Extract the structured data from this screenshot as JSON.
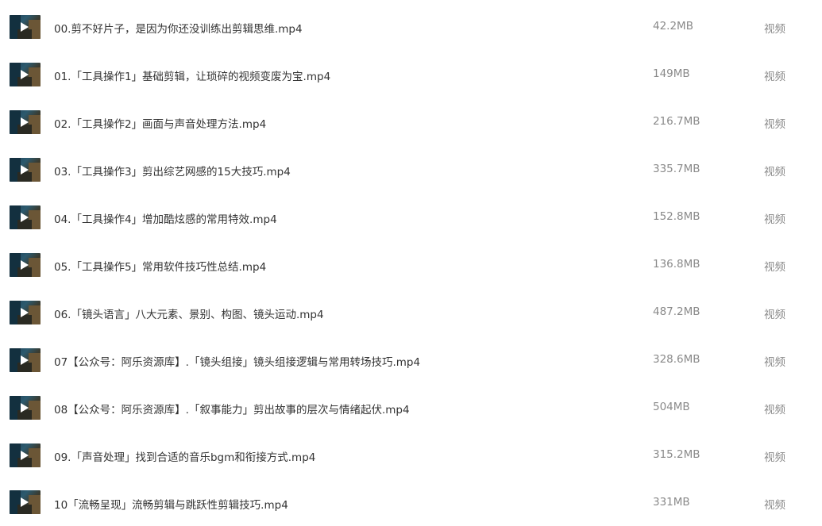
{
  "files": [
    {
      "name": "00.剪不好片子，是因为你还没训练出剪辑思维.mp4",
      "size": "42.2MB",
      "type": "视频",
      "icon": "video-thumbnail-icon"
    },
    {
      "name": "01.「工具操作1」基础剪辑，让琐碎的视频变废为宝.mp4",
      "size": "149MB",
      "type": "视频",
      "icon": "video-thumbnail-icon"
    },
    {
      "name": "02.「工具操作2」画面与声音处理方法.mp4",
      "size": "216.7MB",
      "type": "视频",
      "icon": "video-thumbnail-icon"
    },
    {
      "name": "03.「工具操作3」剪出综艺网感的15大技巧.mp4",
      "size": "335.7MB",
      "type": "视频",
      "icon": "video-thumbnail-icon"
    },
    {
      "name": "04.「工具操作4」增加酷炫感的常用特效.mp4",
      "size": "152.8MB",
      "type": "视频",
      "icon": "video-thumbnail-icon"
    },
    {
      "name": "05.「工具操作5」常用软件技巧性总结.mp4",
      "size": "136.8MB",
      "type": "视频",
      "icon": "video-thumbnail-icon"
    },
    {
      "name": "06.「镜头语言」八大元素、景别、构图、镜头运动.mp4",
      "size": "487.2MB",
      "type": "视频",
      "icon": "video-thumbnail-icon"
    },
    {
      "name": "07【公众号：阿乐资源库】.「镜头组接」镜头组接逻辑与常用转场技巧.mp4",
      "size": "328.6MB",
      "type": "视频",
      "icon": "video-thumbnail-icon"
    },
    {
      "name": "08【公众号：阿乐资源库】.「叙事能力」剪出故事的层次与情绪起伏.mp4",
      "size": "504MB",
      "type": "视频",
      "icon": "video-thumbnail-icon"
    },
    {
      "name": "09.「声音处理」找到合适的音乐bgm和衔接方式.mp4",
      "size": "315.2MB",
      "type": "视频",
      "icon": "video-thumbnail-icon"
    },
    {
      "name": "10「流畅呈现」流畅剪辑与跳跃性剪辑技巧.mp4",
      "size": "331MB",
      "type": "视频",
      "icon": "video-thumbnail-icon"
    }
  ]
}
